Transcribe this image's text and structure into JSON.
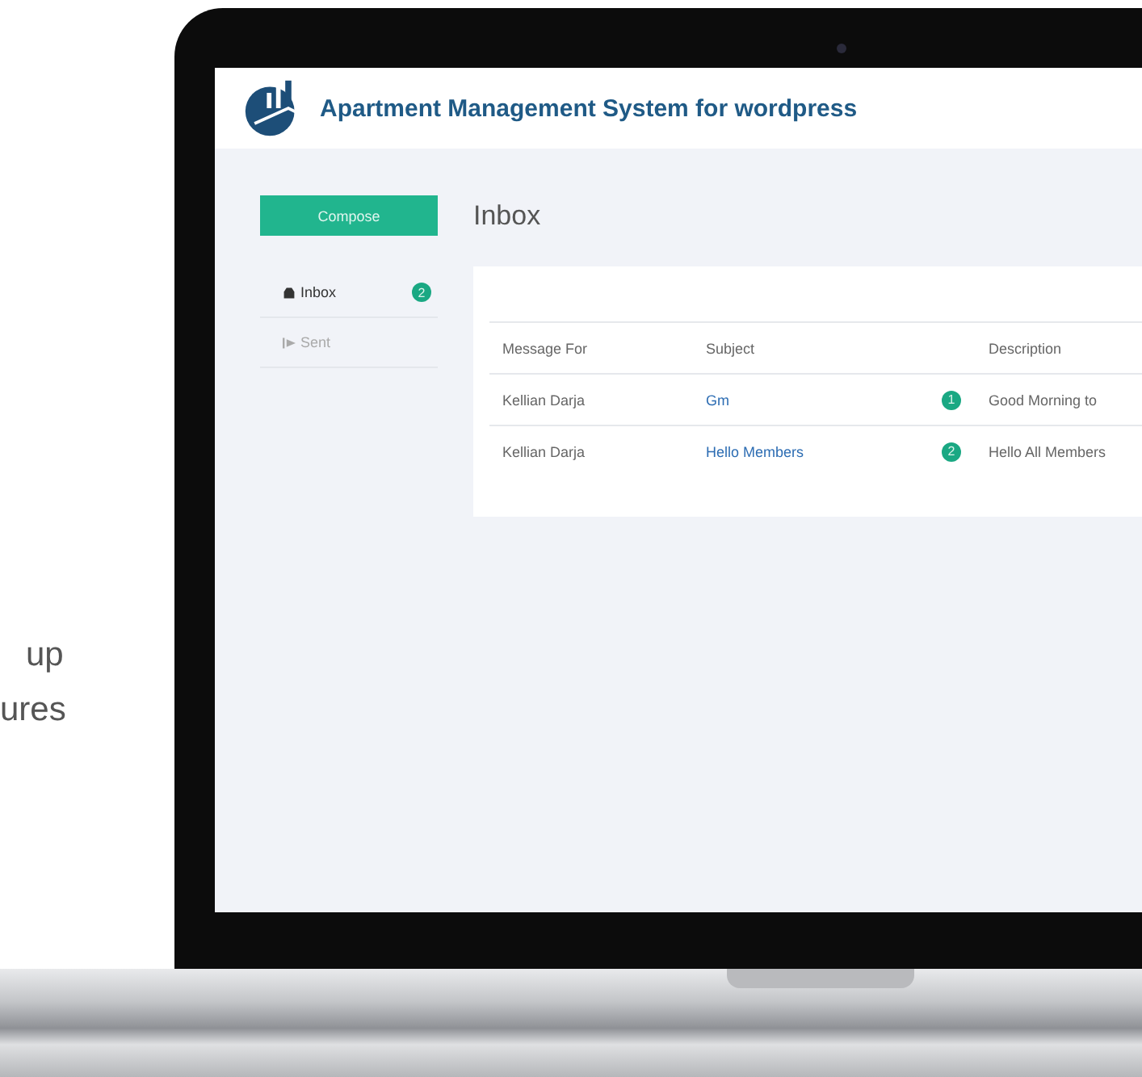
{
  "side_text": [
    "up",
    "ures"
  ],
  "app": {
    "title": "Apartment Management System for wordpress"
  },
  "compose": "Compose",
  "folders": [
    {
      "label": "Inbox",
      "kind": "inbox",
      "count": "2",
      "selected": true
    },
    {
      "label": "Sent",
      "kind": "sent",
      "selected": false
    }
  ],
  "page_title": "Inbox",
  "table": {
    "columns": [
      "Message For",
      "Subject",
      "",
      "Description"
    ],
    "rows": [
      {
        "message_for": "Kellian Darja",
        "subject": "Gm",
        "count": "1",
        "description": "Good Morning to"
      },
      {
        "message_for": "Kellian Darja",
        "subject": "Hello Members",
        "count": "2",
        "description": "Hello All Members"
      }
    ]
  }
}
